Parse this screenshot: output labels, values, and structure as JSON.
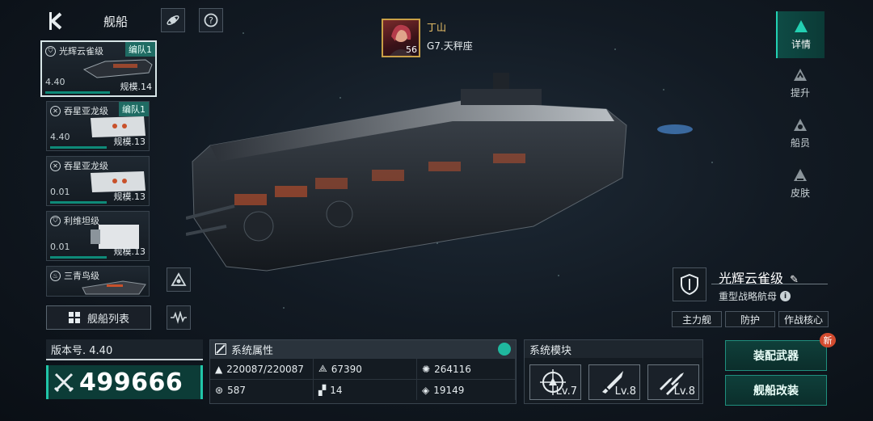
{
  "header": {
    "title": "舰船"
  },
  "ship_list": [
    {
      "name": "光辉云雀级",
      "fleet_tag": "编队1",
      "version": "4.40",
      "scale": "规模.14",
      "selected": true,
      "icon": "shield-icon"
    },
    {
      "name": "吞星亚龙级",
      "fleet_tag": "编队1",
      "version": "4.40",
      "scale": "规模.13",
      "selected": false,
      "icon": "crosshair-icon"
    },
    {
      "name": "吞星亚龙级",
      "fleet_tag": "",
      "version": "0.01",
      "scale": "规模.13",
      "selected": false,
      "icon": "crosshair-icon"
    },
    {
      "name": "利维坦级",
      "fleet_tag": "",
      "version": "0.01",
      "scale": "规模.13",
      "selected": false,
      "icon": "shield-icon"
    },
    {
      "name": "三青鸟级",
      "fleet_tag": "",
      "version": "",
      "scale": "",
      "selected": false,
      "icon": "flame-icon"
    }
  ],
  "ship_list_button": "舰船列表",
  "commander": {
    "name": "丁山",
    "system": "G7.天秤座",
    "level": "56"
  },
  "right_tabs": [
    {
      "label": "详情",
      "active": true
    },
    {
      "label": "提升",
      "active": false
    },
    {
      "label": "船员",
      "active": false
    },
    {
      "label": "皮肤",
      "active": false
    }
  ],
  "ship_info": {
    "name": "光辉云雀级",
    "type": "重型战略航母",
    "tags": [
      "主力舰",
      "防护",
      "作战核心"
    ]
  },
  "version": {
    "label": "版本号. 4.40"
  },
  "power": {
    "value": "499666"
  },
  "attributes": {
    "title": "系统属性",
    "items": [
      {
        "icon": "ship-hull-icon",
        "value": "220087/220087"
      },
      {
        "icon": "formation-icon",
        "value": "67390"
      },
      {
        "icon": "gear-target-icon",
        "value": "264116"
      },
      {
        "icon": "orbit-icon",
        "value": "587"
      },
      {
        "icon": "checker-icon",
        "value": "14"
      },
      {
        "icon": "diamond-target-icon",
        "value": "19149"
      }
    ]
  },
  "modules": {
    "title": "系统模块",
    "items": [
      {
        "icon": "targeting-module-icon",
        "level": "Lv.7"
      },
      {
        "icon": "missile-module-icon",
        "level": "Lv.8"
      },
      {
        "icon": "rockets-module-icon",
        "level": "Lv.8"
      }
    ]
  },
  "actions": {
    "equip": "装配武器",
    "refit": "舰船改装",
    "new_badge": "新"
  },
  "colors": {
    "accent": "#21c5a8",
    "gold": "#f2c76a",
    "badge": "#d24b2f"
  }
}
